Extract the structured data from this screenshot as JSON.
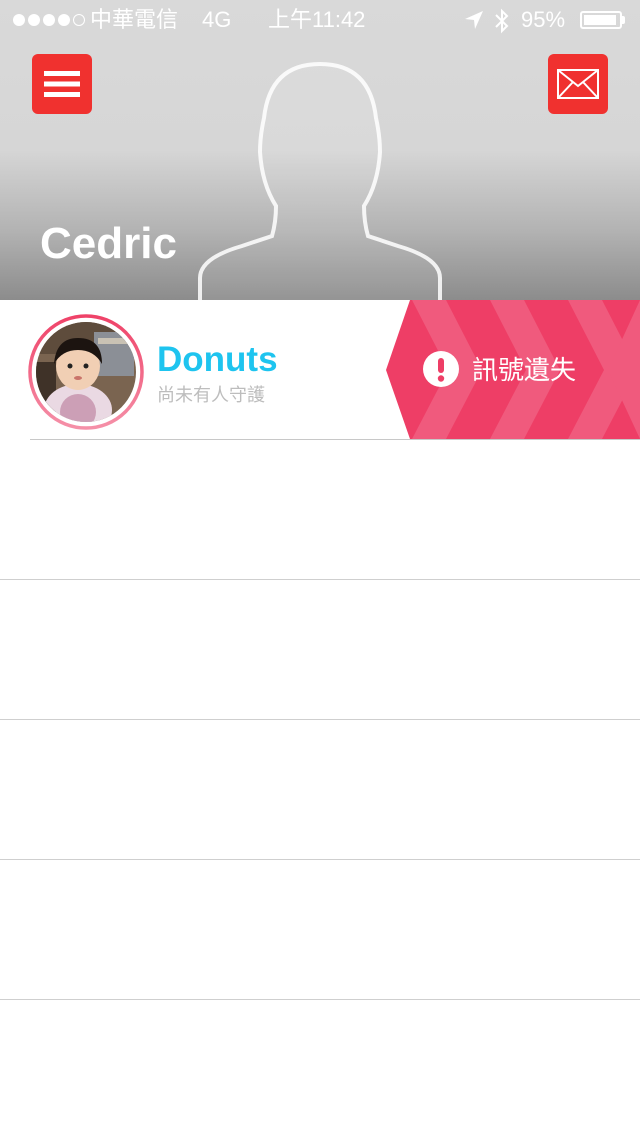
{
  "status_bar": {
    "signal_filled": 4,
    "signal_total": 5,
    "carrier": "中華電信",
    "network": "4G",
    "time": "上午11:42",
    "location_icon": "location-arrow-icon",
    "bluetooth_icon": "bluetooth-icon",
    "battery_percent_label": "95%",
    "battery_level": 0.95
  },
  "header": {
    "menu_icon": "hamburger-menu-icon",
    "mail_icon": "mail-envelope-icon",
    "user_name": "Cedric",
    "accent_color": "#f0312f"
  },
  "pets": [
    {
      "name": "Donuts",
      "status": "尚未有人守護",
      "alert": "訊號遺失",
      "alert_icon": "exclamation-circle-icon",
      "alert_color": "#ee3e66",
      "name_color": "#1ec4ef"
    }
  ],
  "empty_rows": 4
}
